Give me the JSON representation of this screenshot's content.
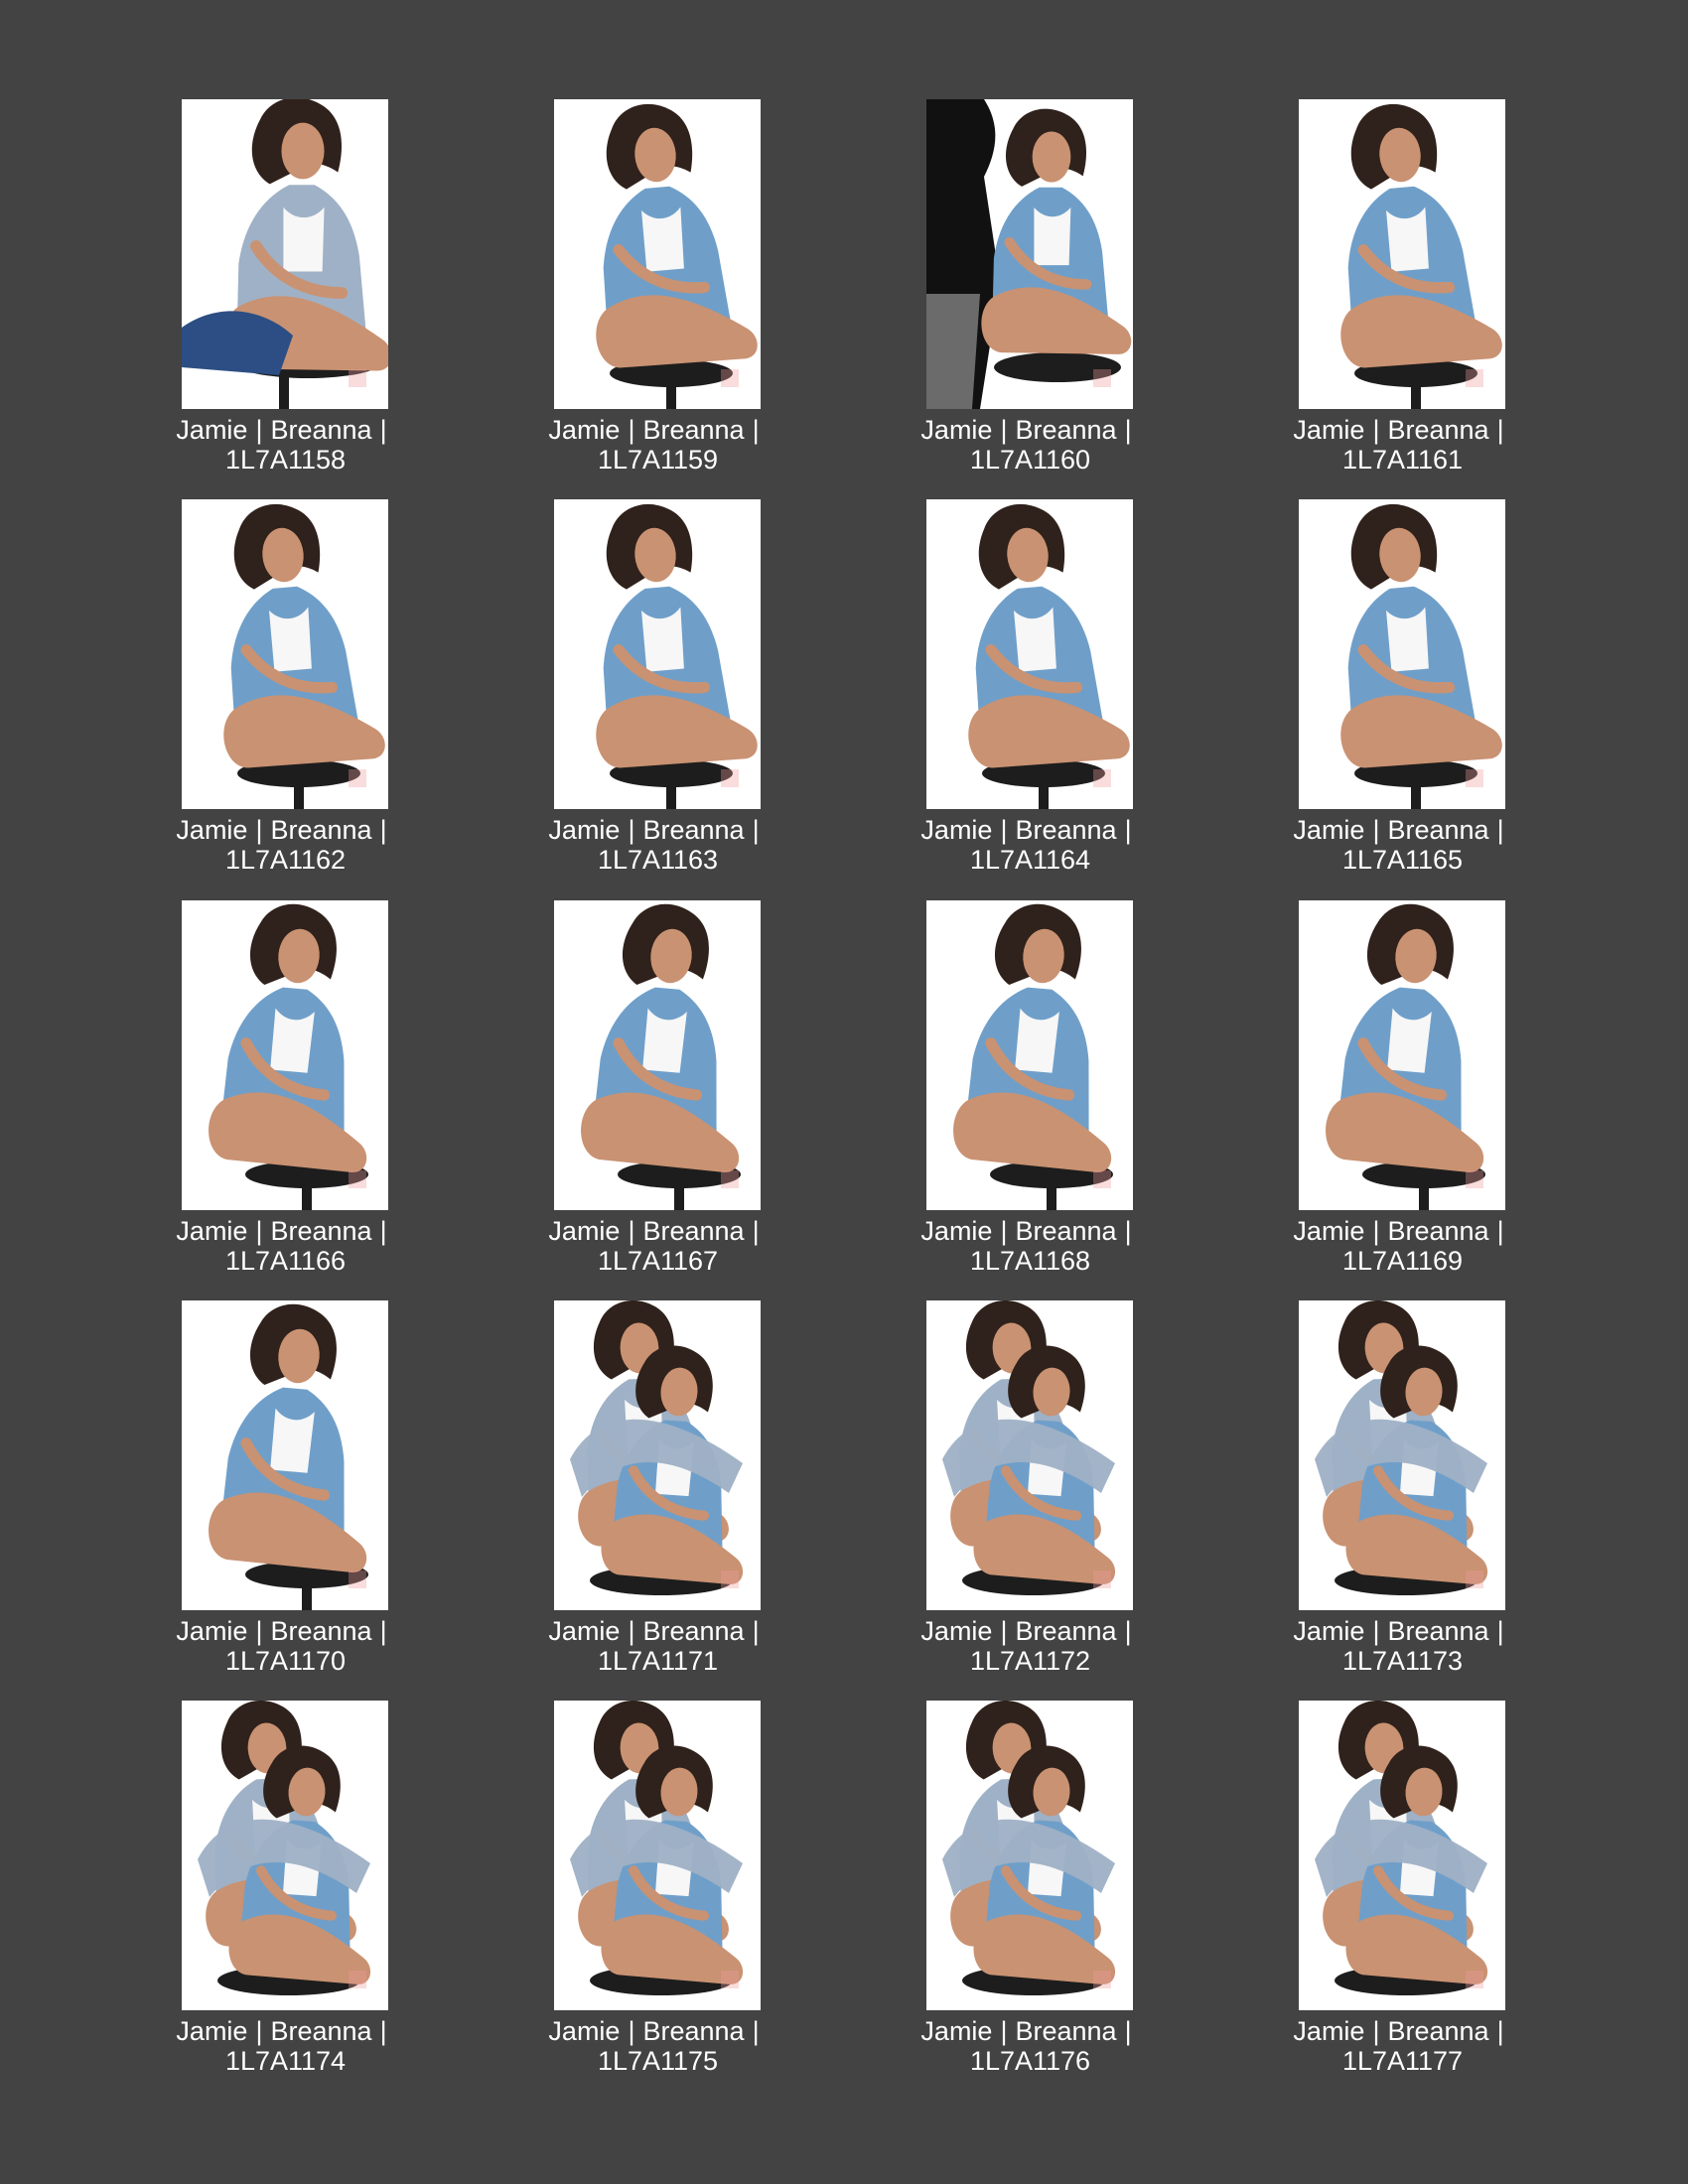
{
  "page": {
    "title": "",
    "background": "#434343"
  },
  "contact_sheet": {
    "separator": "|",
    "thumbnails": [
      {
        "client": "Jamie",
        "subject": "Breanna",
        "file": "1L7A1158",
        "pose": "gray-sweater-seated"
      },
      {
        "client": "Jamie",
        "subject": "Breanna",
        "file": "1L7A1159",
        "pose": "denim-seated-front"
      },
      {
        "client": "Jamie",
        "subject": "Breanna",
        "file": "1L7A1160",
        "pose": "denim-with-assistant"
      },
      {
        "client": "Jamie",
        "subject": "Breanna",
        "file": "1L7A1161",
        "pose": "denim-seated-side"
      },
      {
        "client": "Jamie",
        "subject": "Breanna",
        "file": "1L7A1162",
        "pose": "denim-seated-side"
      },
      {
        "client": "Jamie",
        "subject": "Breanna",
        "file": "1L7A1163",
        "pose": "denim-seated-side"
      },
      {
        "client": "Jamie",
        "subject": "Breanna",
        "file": "1L7A1164",
        "pose": "denim-seated-side"
      },
      {
        "client": "Jamie",
        "subject": "Breanna",
        "file": "1L7A1165",
        "pose": "denim-seated-side"
      },
      {
        "client": "Jamie",
        "subject": "Breanna",
        "file": "1L7A1166",
        "pose": "denim-seated-left"
      },
      {
        "client": "Jamie",
        "subject": "Breanna",
        "file": "1L7A1167",
        "pose": "denim-seated-left"
      },
      {
        "client": "Jamie",
        "subject": "Breanna",
        "file": "1L7A1168",
        "pose": "denim-seated-left"
      },
      {
        "client": "Jamie",
        "subject": "Breanna",
        "file": "1L7A1169",
        "pose": "denim-seated-left"
      },
      {
        "client": "Jamie",
        "subject": "Breanna",
        "file": "1L7A1170",
        "pose": "denim-seated-left"
      },
      {
        "client": "Jamie",
        "subject": "Breanna",
        "file": "1L7A1171",
        "pose": "two-people"
      },
      {
        "client": "Jamie",
        "subject": "Breanna",
        "file": "1L7A1172",
        "pose": "two-people"
      },
      {
        "client": "Jamie",
        "subject": "Breanna",
        "file": "1L7A1173",
        "pose": "two-people"
      },
      {
        "client": "Jamie",
        "subject": "Breanna",
        "file": "1L7A1174",
        "pose": "two-people"
      },
      {
        "client": "Jamie",
        "subject": "Breanna",
        "file": "1L7A1175",
        "pose": "two-people"
      },
      {
        "client": "Jamie",
        "subject": "Breanna",
        "file": "1L7A1176",
        "pose": "two-people"
      },
      {
        "client": "Jamie",
        "subject": "Breanna",
        "file": "1L7A1177",
        "pose": "two-people"
      }
    ]
  },
  "colors": {
    "page_background": "#434343",
    "thumbnail_background": "#ffffff",
    "caption_text": "#ffffff",
    "denim": "#6f9fc9",
    "sweater": "#9fb1c6",
    "skin": "#c99272",
    "hair": "#2f211b",
    "stool": "#1d1d1d"
  }
}
